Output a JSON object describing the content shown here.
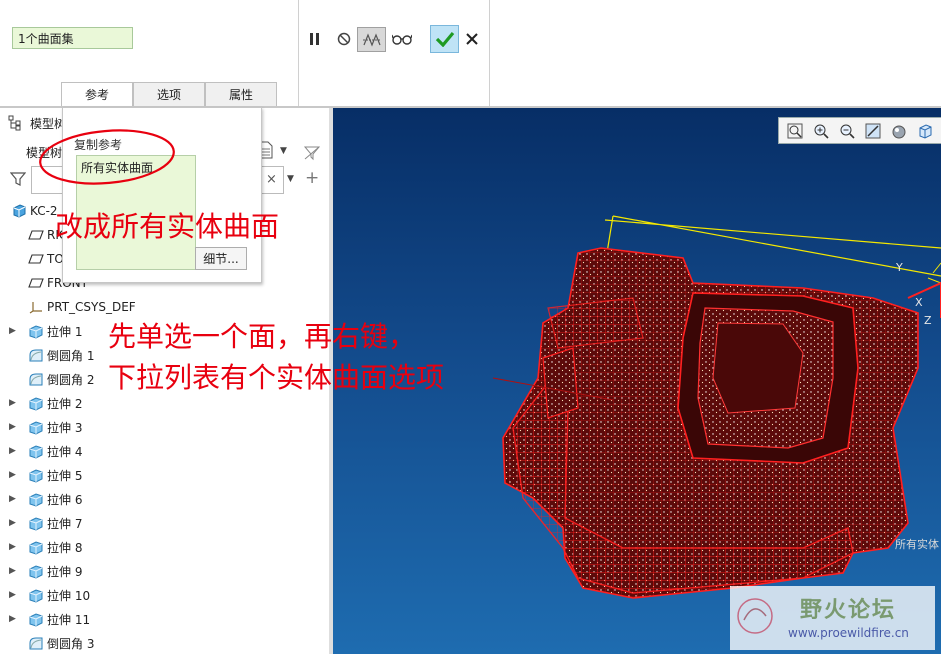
{
  "ribbon": {
    "surface_set_value": "1个曲面集",
    "tools": [
      "pause-icon",
      "no-preview-icon",
      "verify-icon",
      "glasses-icon",
      "confirm-icon",
      "cancel-icon"
    ]
  },
  "tabs": [
    {
      "label": "参考",
      "active": true
    },
    {
      "label": "选项",
      "active": false
    },
    {
      "label": "属性",
      "active": false
    }
  ],
  "popup": {
    "title": "复制参考",
    "item": "所有实体曲面",
    "detail_button": "细节..."
  },
  "model_tree": {
    "header_label": "模型树",
    "sub_header_label": "模型树",
    "items": [
      {
        "label": "KC-2",
        "icon": "part-icon",
        "expand": false
      },
      {
        "label": "RIGHT",
        "icon": "datum-plane-icon",
        "expand": false
      },
      {
        "label": "TOP",
        "icon": "datum-plane-icon",
        "expand": false
      },
      {
        "label": "FRONT",
        "icon": "datum-plane-icon",
        "expand": false
      },
      {
        "label": "PRT_CSYS_DEF",
        "icon": "csys-icon",
        "expand": false
      },
      {
        "label": "拉伸 1",
        "icon": "extrude-icon",
        "expand": true
      },
      {
        "label": "倒圆角 1",
        "icon": "round-icon",
        "expand": false
      },
      {
        "label": "倒圆角 2",
        "icon": "round-icon",
        "expand": false
      },
      {
        "label": "拉伸 2",
        "icon": "extrude-icon",
        "expand": true
      },
      {
        "label": "拉伸 3",
        "icon": "extrude-icon",
        "expand": true
      },
      {
        "label": "拉伸 4",
        "icon": "extrude-icon",
        "expand": true
      },
      {
        "label": "拉伸 5",
        "icon": "extrude-icon",
        "expand": true
      },
      {
        "label": "拉伸 6",
        "icon": "extrude-icon",
        "expand": true
      },
      {
        "label": "拉伸 7",
        "icon": "extrude-icon",
        "expand": true
      },
      {
        "label": "拉伸 8",
        "icon": "extrude-icon",
        "expand": true
      },
      {
        "label": "拉伸 9",
        "icon": "extrude-icon",
        "expand": true
      },
      {
        "label": "拉伸 10",
        "icon": "extrude-icon",
        "expand": true
      },
      {
        "label": "拉伸 11",
        "icon": "extrude-icon",
        "expand": true
      },
      {
        "label": "倒圆角 3",
        "icon": "round-icon",
        "expand": false
      }
    ]
  },
  "viewport": {
    "toolbar": [
      "zoom-fit-icon",
      "zoom-in-icon",
      "zoom-out-icon",
      "repaint-icon",
      "display-style-icon",
      "view-orient-icon"
    ],
    "axis_labels": [
      "X",
      "Y",
      "Z"
    ],
    "status_fragment": "所有实体"
  },
  "annotations": {
    "note1": "改成所有实体曲面",
    "note2_line1": "先单选一个面，再右键，",
    "note2_line2": "下拉列表有个实体曲面选项",
    "color": "#e8000f"
  },
  "watermark": {
    "title": "野火论坛",
    "url": "www.proewildfire.cn"
  }
}
